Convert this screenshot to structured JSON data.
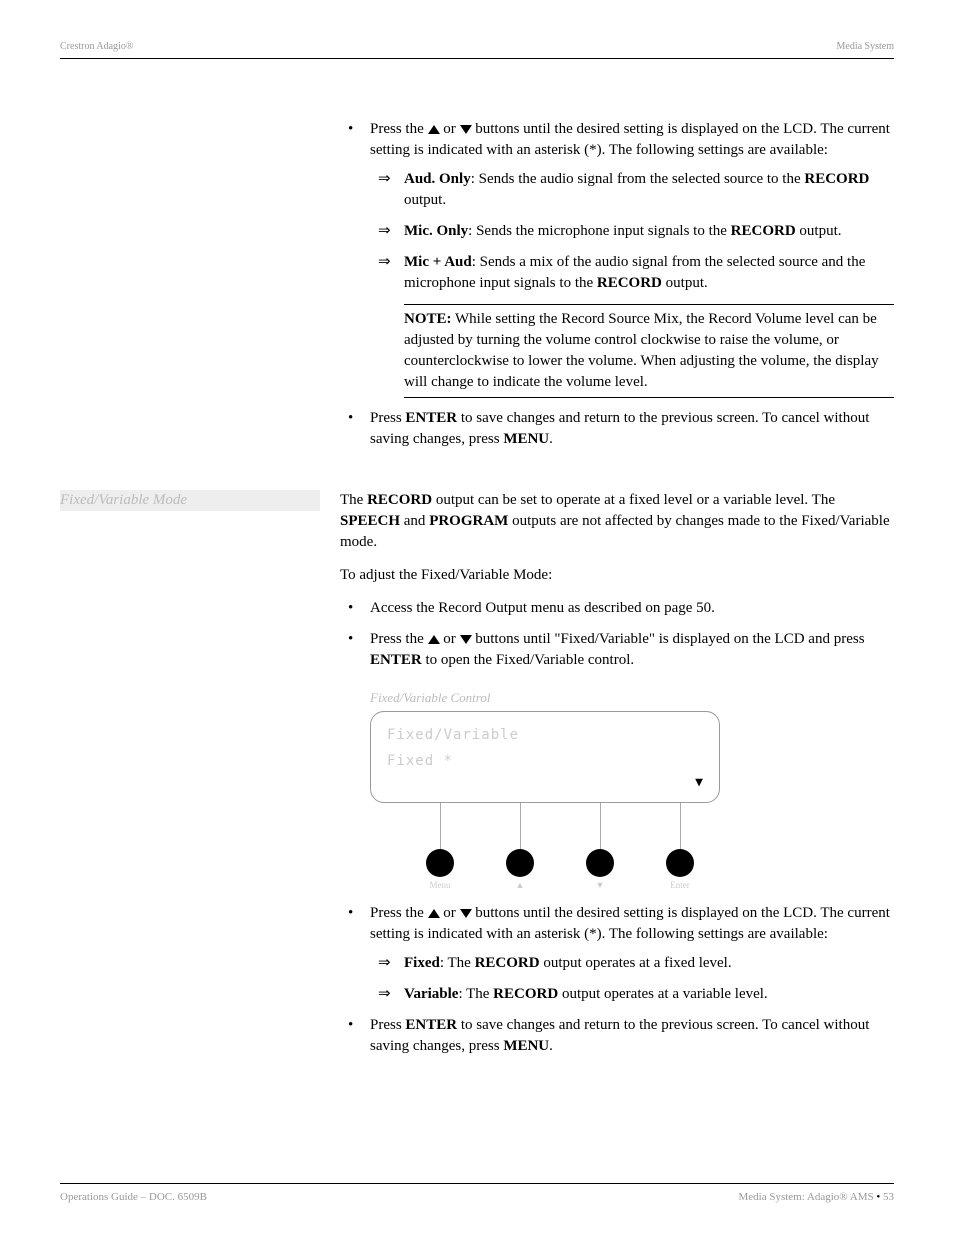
{
  "header": {
    "left": "Crestron Adagio®",
    "right": "Media System"
  },
  "s1": {
    "b1_pre": "Press the ",
    "b1_mid": " or ",
    "b1_post": " buttons until the desired setting is displayed on the LCD. The current setting is indicated with an asterisk (*). The following settings are available:",
    "a1_label": "Aud. Only",
    "a1_text": ": Sends the audio signal from the selected source to the ",
    "a1_bold": "RECORD",
    "a1_end": " output.",
    "a2_label": "Mic. Only",
    "a2_text": ": Sends the microphone input signals to the ",
    "a2_bold": "RECORD",
    "a2_end": " output.",
    "a3_label": "Mic + Aud",
    "a3_text": ": Sends a mix of the audio signal from the selected source and the microphone input signals to the ",
    "a3_bold": "RECORD",
    "a3_end": " output.",
    "note_label": "NOTE:",
    "note_text": "  While setting the Record Source Mix, the Record Volume level can be adjusted by turning the volume control clockwise to raise the volume, or counterclockwise to lower the volume. When adjusting the volume, the display will change to indicate the volume level.",
    "b2_pre": "Press ",
    "b2_bold1": "ENTER",
    "b2_mid": " to save changes and return to the previous screen. To cancel without saving changes, press ",
    "b2_bold2": "MENU",
    "b2_end": "."
  },
  "sidebar": {
    "label": "Fixed/Variable Mode"
  },
  "s2": {
    "p1_pre": "The ",
    "p1_b1": "RECORD",
    "p1_mid1": " output can be set to operate at a fixed level or a variable level. The ",
    "p1_b2": "SPEECH",
    "p1_mid2": " and ",
    "p1_b3": "PROGRAM",
    "p1_end": " outputs are not affected by changes made to the Fixed/Variable mode.",
    "p2": "To adjust the Fixed/Variable Mode:",
    "b1": "Access the Record Output menu as described on page 50.",
    "b2_pre": "Press the ",
    "b2_mid": " or ",
    "b2_post": " buttons until \"Fixed/Variable\" is displayed on the LCD and press ",
    "b2_bold": "ENTER",
    "b2_end": " to open the Fixed/Variable control.",
    "caption": "Fixed/Variable Control",
    "lcd_line1": "Fixed/Variable",
    "lcd_line2": "Fixed       *",
    "knobs": [
      "Menu",
      "▲",
      "▼",
      "Enter"
    ],
    "b3_pre": "Press the ",
    "b3_mid": " or ",
    "b3_post": " buttons until the desired setting is displayed on the LCD. The current setting is indicated with an asterisk (*). The following settings are available:",
    "a1_label": "Fixed",
    "a1_text": ": The ",
    "a1_bold": "RECORD",
    "a1_end": " output operates at a fixed level.",
    "a2_label": "Variable",
    "a2_text": ": The ",
    "a2_bold": "RECORD",
    "a2_end": " output operates at a variable level.",
    "b4_pre": "Press ",
    "b4_bold1": "ENTER",
    "b4_mid": " to save changes and return to the previous screen. To cancel without saving changes, press ",
    "b4_bold2": "MENU",
    "b4_end": "."
  },
  "footer": {
    "left": "Operations Guide – DOC. 6509B",
    "right_pre": "Media System: Adagio® AMS ",
    "right_bullet": "•",
    "right_post": " 53"
  }
}
